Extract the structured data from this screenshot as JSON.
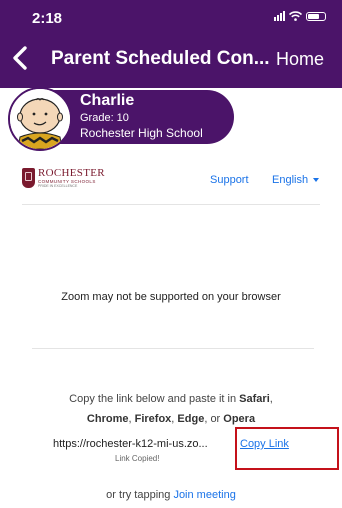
{
  "status_bar": {
    "time": "2:18"
  },
  "nav": {
    "title": "Parent Scheduled Con...",
    "home": "Home"
  },
  "student": {
    "name": "Charlie",
    "grade": "Grade: 10",
    "school": "Rochester High School"
  },
  "logo": {
    "main": "ROCHESTER",
    "sub": "COMMUNITY SCHOOLS",
    "sub2": "PRIDE IN EXCELLENCE"
  },
  "links": {
    "support": "Support",
    "language": "English"
  },
  "message": {
    "zoom": "Zoom may not be supported on your browser"
  },
  "instructions": {
    "line1_a": "Copy the link below and paste it in ",
    "safari": "Safari",
    "line1_b": ",",
    "chrome": "Chrome",
    "sep1": ", ",
    "firefox": "Firefox",
    "sep2": ", ",
    "edge": "Edge",
    "or": ", or ",
    "opera": "Opera"
  },
  "meeting": {
    "url": "https://rochester-k12-mi-us.zo...",
    "copy_link": "Copy Link",
    "copied": "Link Copied!",
    "try_prefix": "or try tapping ",
    "join": "Join meeting"
  },
  "colors": {
    "header": "#4b1469",
    "link": "#1a73e8",
    "brand": "#7a1a2e",
    "highlight": "#c4111a"
  }
}
